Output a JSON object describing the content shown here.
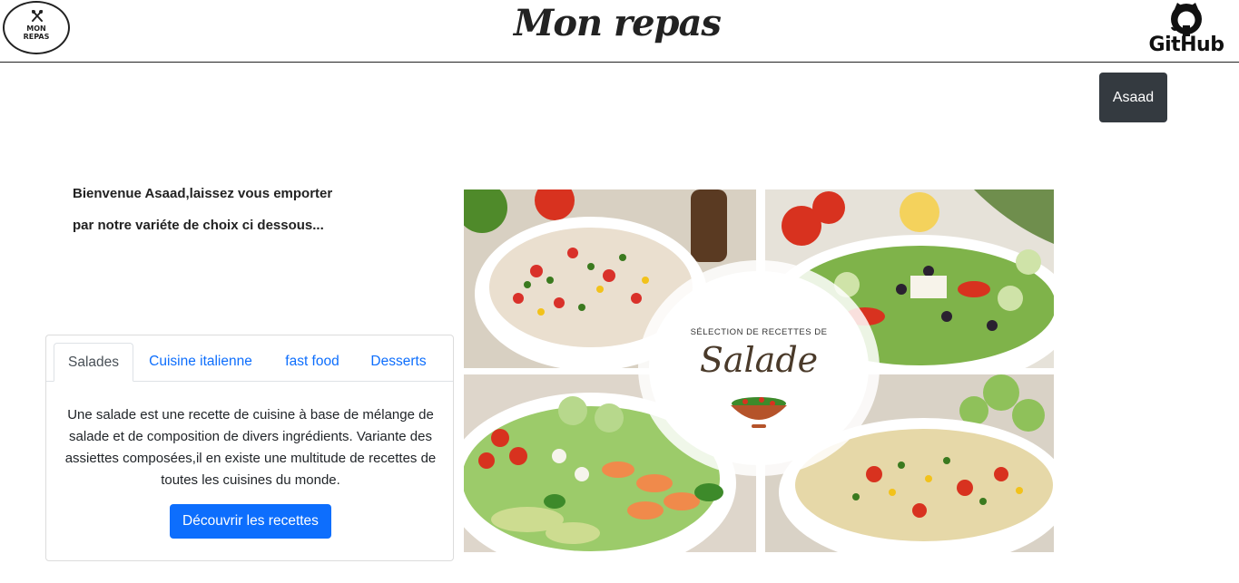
{
  "header": {
    "logo_text_line1": "MON",
    "logo_text_line2": "REPAS",
    "title": "Mon repas",
    "github_label": "GitHub"
  },
  "user": {
    "name": "Asaad"
  },
  "welcome": {
    "line1": "Bienvenue Asaad,laissez vous emporter",
    "line2": "par notre variéte de choix ci dessous..."
  },
  "tabs": [
    {
      "label": "Salades",
      "active": true
    },
    {
      "label": "Cuisine italienne",
      "active": false
    },
    {
      "label": "fast food",
      "active": false
    },
    {
      "label": "Desserts",
      "active": false
    }
  ],
  "card": {
    "text": "Une salade est une recette de cuisine à base de mélange de salade et de composition de divers ingrédients. Variante des assiettes composées,il en existe une multitude de recettes de toutes les cuisines du monde.",
    "button_label": "Découvrir les recettes"
  },
  "image": {
    "subtitle": "SÉLECTION DE RECETTES DE",
    "title": "Salade"
  },
  "colors": {
    "dark_button": "#343a40",
    "primary": "#0d6efd",
    "tab_link": "#0d6efd"
  }
}
